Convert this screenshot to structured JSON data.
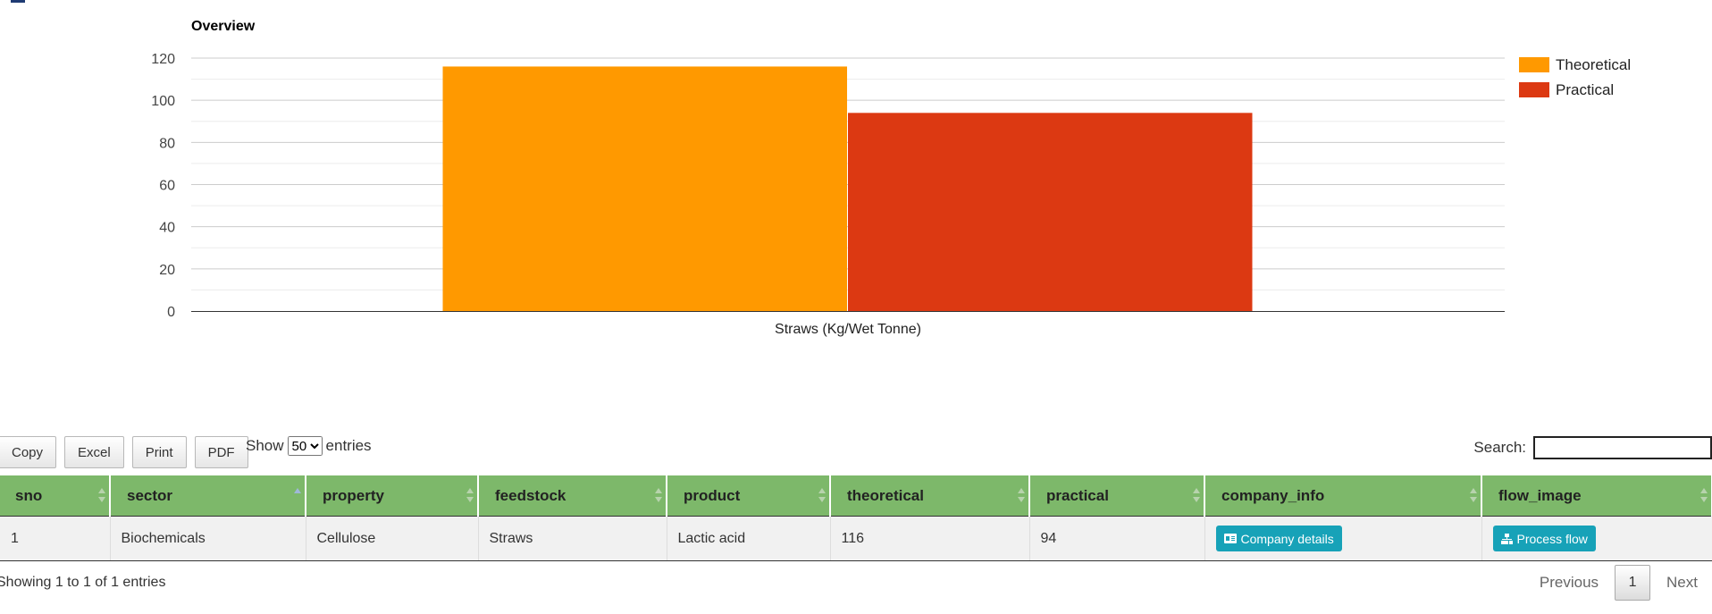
{
  "chart_data": {
    "type": "bar",
    "title": "Overview",
    "categories": [
      "Straws (Kg/Wet Tonne)"
    ],
    "series": [
      {
        "name": "Theoretical",
        "values": [
          116
        ],
        "color": "#ff9900"
      },
      {
        "name": "Practical",
        "values": [
          94
        ],
        "color": "#dc3912"
      }
    ],
    "ylim": [
      0,
      120
    ],
    "y_ticks": [
      0,
      20,
      40,
      60,
      80,
      100,
      120
    ],
    "grid": true,
    "legend_position": "right"
  },
  "toolbar": {
    "buttons": [
      "Copy",
      "Excel",
      "Print",
      "PDF"
    ],
    "show_label": "Show",
    "entries_label": "entries",
    "page_length": "50",
    "search_label": "Search:",
    "search_value": ""
  },
  "table": {
    "columns": [
      "sno",
      "sector",
      "property",
      "feedstock",
      "product",
      "theoretical",
      "practical",
      "company_info",
      "flow_image"
    ],
    "rows": [
      {
        "sno": "1",
        "sector": "Biochemicals",
        "property": "Cellulose",
        "feedstock": "Straws",
        "product": "Lactic acid",
        "theoretical": "116",
        "practical": "94",
        "company_info": "Company details",
        "flow_image": "Process flow"
      }
    ]
  },
  "footer": {
    "info": "Showing 1 to 1 of 1 entries",
    "previous": "Previous",
    "page": "1",
    "next": "Next"
  },
  "icons": {
    "company_button": "id-card-icon",
    "flow_button": "sitemap-icon"
  }
}
